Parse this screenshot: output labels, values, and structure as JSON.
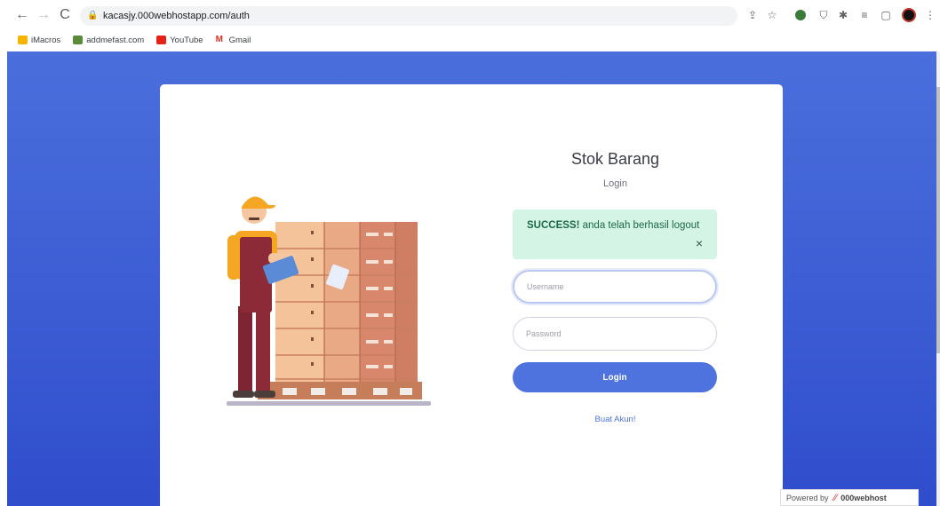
{
  "browser": {
    "url": "kacasjy.000webhostapp.com/auth",
    "bookmarks": [
      {
        "label": "iMacros",
        "color": "#f4b400"
      },
      {
        "label": "addmefast.com",
        "color": "#5a8a3a"
      },
      {
        "label": "YouTube",
        "color": "#e62117"
      },
      {
        "label": "Gmail",
        "color": "#d93025"
      }
    ]
  },
  "login": {
    "title": "Stok Barang",
    "subtitle": "Login",
    "alert": {
      "strong": "SUCCESS!",
      "message": " anda telah berhasil logout",
      "close": "×"
    },
    "username_placeholder": "Username",
    "password_placeholder": "Password",
    "button": "Login",
    "register_link": "Buat Akun!"
  },
  "footer": {
    "powered_by": "Powered by",
    "brand": "000webhost"
  },
  "colors": {
    "primary": "#4e73df",
    "alert_bg": "#d4f5e6"
  }
}
